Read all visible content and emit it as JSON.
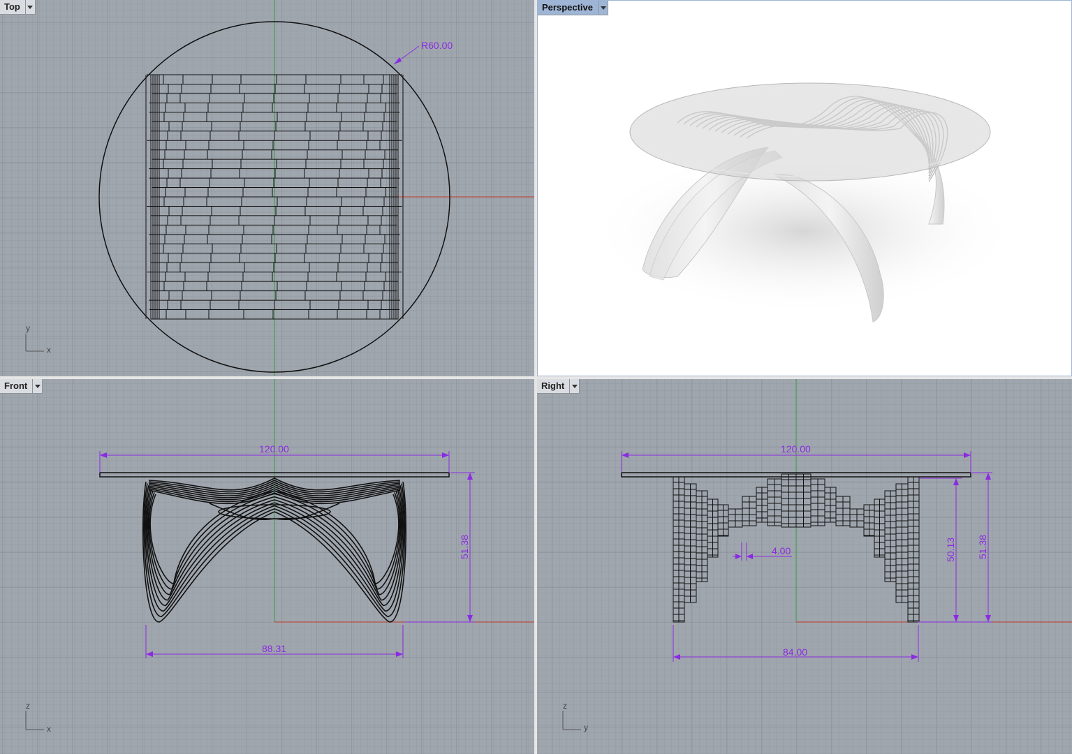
{
  "viewports": {
    "top": {
      "label": "Top",
      "dimension": "R60.00",
      "axis_v": "y",
      "axis_h": "x"
    },
    "perspective": {
      "label": "Perspective"
    },
    "front": {
      "label": "Front",
      "dim_width": "120.00",
      "dim_height": "51.38",
      "dim_base": "88.31",
      "axis_v": "z",
      "axis_h": "x"
    },
    "right": {
      "label": "Right",
      "dim_width": "120.00",
      "dim_height_inner": "50.13",
      "dim_height": "51.38",
      "dim_gap": "4.00",
      "dim_base": "84.00",
      "axis_v": "z",
      "axis_h": "y"
    }
  },
  "colors": {
    "grid_bg": "#a0a6ae",
    "dimension": "#8a2be2",
    "axis_x": "#c0392b",
    "axis_y": "#2e9e3e",
    "active_tab": "#9fb5d5"
  }
}
